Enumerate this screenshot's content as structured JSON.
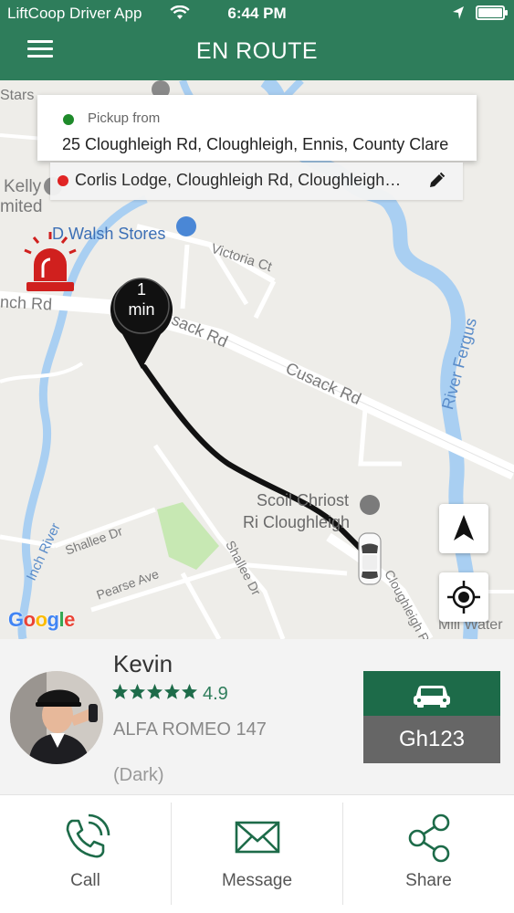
{
  "status_bar": {
    "carrier": "LiftCoop Driver App",
    "time": "6:44 PM",
    "battery_level": 1.0
  },
  "header": {
    "title": "EN ROUTE",
    "menu_icon": "hamburger-menu-icon"
  },
  "map": {
    "labels": {
      "stars": "Stars",
      "kelly": "Kelly",
      "limited": "mited",
      "walsh": "D Walsh Stores",
      "victoria": "Victoria Ct",
      "inch_rd": "nch Rd",
      "cusack1": "sack Rd",
      "cusack2": "Cusack Rd",
      "river_fergus": "River Fergus",
      "scoil1": "Scoil Chriost",
      "scoil2": "Ri Cloughleigh",
      "shallee1": "Shallee Dr",
      "shallee2": "Shallee Dr",
      "pearse": "Pearse Ave",
      "inch_river": "Inch River",
      "cloughleigh": "Cloughleigh R",
      "mill": "Mill Water"
    },
    "eta": {
      "value": "1",
      "unit": "min"
    },
    "google_logo": [
      "G",
      "o",
      "o",
      "g",
      "l",
      "e"
    ],
    "google_colors": [
      "#4285F4",
      "#EA4335",
      "#FBBC05",
      "#4285F4",
      "#34A853",
      "#EA4335"
    ]
  },
  "pickup": {
    "label": "Pickup from",
    "address": "25 Cloughleigh Rd,  Cloughleigh,  Ennis,  County Clare"
  },
  "dropoff": {
    "address": "Corlis Lodge,  Cloughleigh Rd,  Cloughleigh,  Ennis"
  },
  "driver": {
    "name": "Kevin",
    "rating": "4.9",
    "stars": 5,
    "car_model": "ALFA ROMEO 147",
    "car_color": "(Dark)",
    "plate": "Gh123"
  },
  "actions": {
    "call": "Call",
    "message": "Message",
    "share": "Share"
  },
  "colors": {
    "brand_green": "#2e7d5b",
    "plate_green": "#1d6b49",
    "pickup_dot": "#1e8a2a",
    "drop_dot": "#e11b1b",
    "siren_red": "#d0201e"
  }
}
